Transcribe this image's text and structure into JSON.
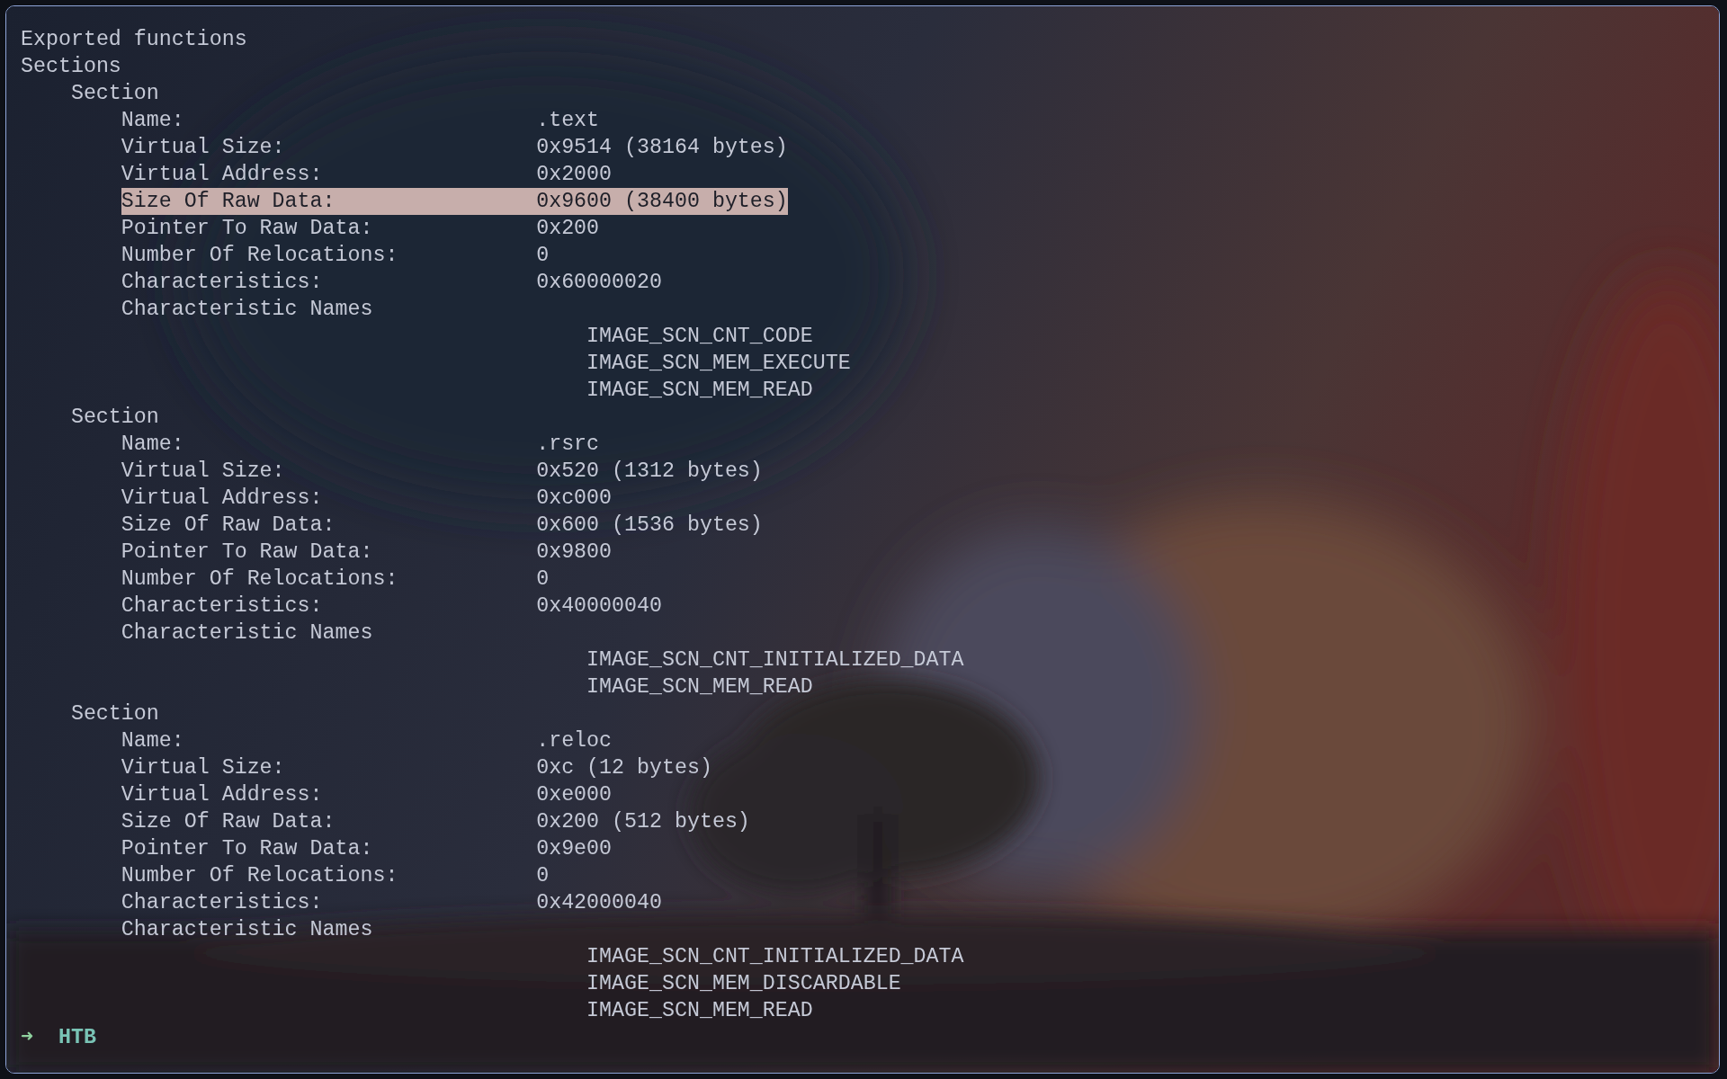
{
  "headings": [
    "Exported functions",
    "Sections"
  ],
  "sections": [
    {
      "title": "Section",
      "fields": [
        {
          "label": "Name:",
          "value": ".text",
          "selected": false
        },
        {
          "label": "Virtual Size:",
          "value": "0x9514 (38164 bytes)",
          "selected": false
        },
        {
          "label": "Virtual Address:",
          "value": "0x2000",
          "selected": false
        },
        {
          "label": "Size Of Raw Data:",
          "value": "0x9600 (38400 bytes)",
          "selected": true
        },
        {
          "label": "Pointer To Raw Data:",
          "value": "0x200",
          "selected": false
        },
        {
          "label": "Number Of Relocations:",
          "value": "0",
          "selected": false
        },
        {
          "label": "Characteristics:",
          "value": "0x60000020",
          "selected": false
        }
      ],
      "names_label": "Characteristic Names",
      "names": [
        "IMAGE_SCN_CNT_CODE",
        "IMAGE_SCN_MEM_EXECUTE",
        "IMAGE_SCN_MEM_READ"
      ]
    },
    {
      "title": "Section",
      "fields": [
        {
          "label": "Name:",
          "value": ".rsrc",
          "selected": false
        },
        {
          "label": "Virtual Size:",
          "value": "0x520 (1312 bytes)",
          "selected": false
        },
        {
          "label": "Virtual Address:",
          "value": "0xc000",
          "selected": false
        },
        {
          "label": "Size Of Raw Data:",
          "value": "0x600 (1536 bytes)",
          "selected": false
        },
        {
          "label": "Pointer To Raw Data:",
          "value": "0x9800",
          "selected": false
        },
        {
          "label": "Number Of Relocations:",
          "value": "0",
          "selected": false
        },
        {
          "label": "Characteristics:",
          "value": "0x40000040",
          "selected": false
        }
      ],
      "names_label": "Characteristic Names",
      "names": [
        "IMAGE_SCN_CNT_INITIALIZED_DATA",
        "IMAGE_SCN_MEM_READ"
      ]
    },
    {
      "title": "Section",
      "fields": [
        {
          "label": "Name:",
          "value": ".reloc",
          "selected": false
        },
        {
          "label": "Virtual Size:",
          "value": "0xc (12 bytes)",
          "selected": false
        },
        {
          "label": "Virtual Address:",
          "value": "0xe000",
          "selected": false
        },
        {
          "label": "Size Of Raw Data:",
          "value": "0x200 (512 bytes)",
          "selected": false
        },
        {
          "label": "Pointer To Raw Data:",
          "value": "0x9e00",
          "selected": false
        },
        {
          "label": "Number Of Relocations:",
          "value": "0",
          "selected": false
        },
        {
          "label": "Characteristics:",
          "value": "0x42000040",
          "selected": false
        }
      ],
      "names_label": "Characteristic Names",
      "names": [
        "IMAGE_SCN_CNT_INITIALIZED_DATA",
        "IMAGE_SCN_MEM_DISCARDABLE",
        "IMAGE_SCN_MEM_READ"
      ]
    }
  ],
  "prompt": {
    "arrow": "➜",
    "directory": "HTB"
  }
}
